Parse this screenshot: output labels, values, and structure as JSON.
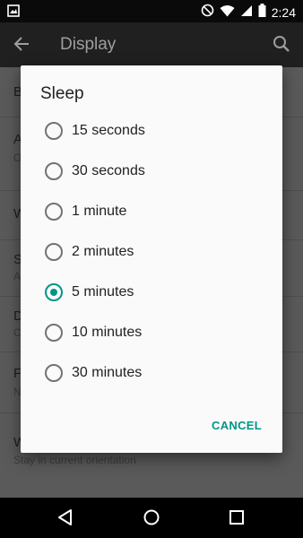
{
  "status_bar": {
    "time": "2:24"
  },
  "app_bar": {
    "title": "Display"
  },
  "settings_background": [
    {
      "title": "B",
      "subtitle": ""
    },
    {
      "title": "A",
      "subtitle": "O"
    },
    {
      "title": "W",
      "subtitle": ""
    },
    {
      "title": "S",
      "subtitle": "A"
    },
    {
      "title": "D",
      "subtitle": "C"
    },
    {
      "title": "F",
      "subtitle": "N"
    },
    {
      "title": "W",
      "subtitle": "Stay in current orientation"
    }
  ],
  "dialog": {
    "title": "Sleep",
    "options": [
      {
        "label": "15 seconds",
        "selected": false
      },
      {
        "label": "30 seconds",
        "selected": false
      },
      {
        "label": "1 minute",
        "selected": false
      },
      {
        "label": "2 minutes",
        "selected": false
      },
      {
        "label": "5 minutes",
        "selected": true
      },
      {
        "label": "10 minutes",
        "selected": false
      },
      {
        "label": "30 minutes",
        "selected": false
      }
    ],
    "cancel_label": "CANCEL"
  },
  "colors": {
    "accent": "#009688",
    "dialog_bg": "#fafafa",
    "scrim": "#5a5a5a"
  },
  "icons": {
    "status_left": "image-icon",
    "status_right": [
      "do-not-disturb-icon",
      "wifi-icon",
      "signal-icon",
      "battery-icon"
    ],
    "nav": [
      "back-icon",
      "home-icon",
      "recents-icon"
    ]
  }
}
